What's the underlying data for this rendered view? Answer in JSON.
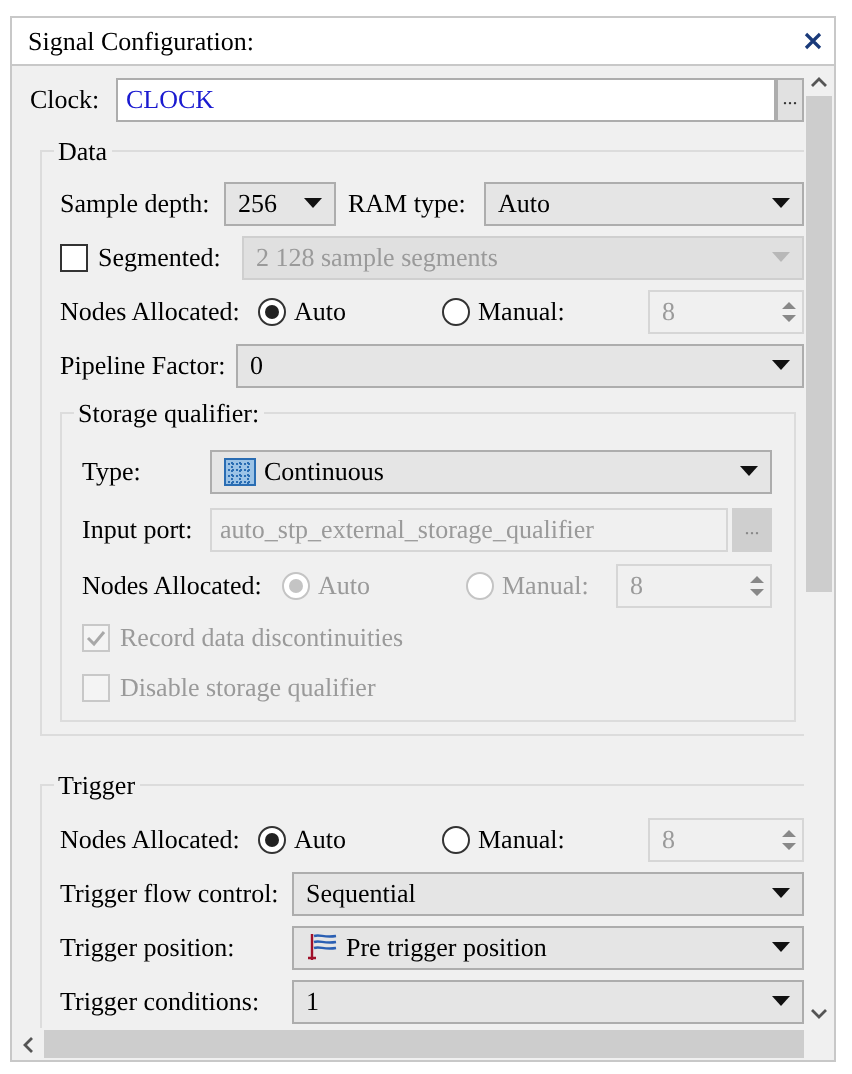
{
  "title": "Signal Configuration:",
  "clock": {
    "label": "Clock:",
    "value": "CLOCK",
    "browse": "..."
  },
  "data": {
    "title": "Data",
    "sample_depth": {
      "label": "Sample depth:",
      "value": "256"
    },
    "ram_type": {
      "label": "RAM type:",
      "value": "Auto"
    },
    "segmented": {
      "label": "Segmented:",
      "checked": false,
      "value": "2  128 sample segments",
      "disabled": true
    },
    "nodes": {
      "label": "Nodes Allocated:",
      "disabled": false,
      "options": [
        {
          "label": "Auto",
          "selected": true
        },
        {
          "label": "Manual:",
          "selected": false
        }
      ],
      "spin": {
        "value": "8",
        "disabled": true
      }
    },
    "pipeline": {
      "label": "Pipeline Factor:",
      "value": "0"
    },
    "storage": {
      "title": "Storage qualifier:",
      "type": {
        "label": "Type:",
        "value": "Continuous"
      },
      "input_port": {
        "label": "Input port:",
        "value": "auto_stp_external_storage_qualifier",
        "browse": "...",
        "disabled": true
      },
      "nodes": {
        "label": "Nodes Allocated:",
        "disabled": true,
        "options": [
          {
            "label": "Auto",
            "selected": true
          },
          {
            "label": "Manual:",
            "selected": false
          }
        ],
        "spin": {
          "value": "8",
          "disabled": true
        }
      },
      "checkboxes": [
        {
          "label": "Record data discontinuities",
          "checked": true,
          "disabled": true
        },
        {
          "label": "Disable storage qualifier",
          "checked": false,
          "disabled": true
        }
      ]
    }
  },
  "trigger": {
    "title": "Trigger",
    "nodes": {
      "label": "Nodes Allocated:",
      "disabled": false,
      "options": [
        {
          "label": "Auto",
          "selected": true
        },
        {
          "label": "Manual:",
          "selected": false
        }
      ],
      "spin": {
        "value": "8",
        "disabled": true
      }
    },
    "flow": {
      "label": "Trigger flow control:",
      "value": "Sequential"
    },
    "position": {
      "label": "Trigger position:",
      "value": "Pre trigger position"
    },
    "conditions": {
      "label": "Trigger conditions:",
      "value": "1"
    }
  }
}
